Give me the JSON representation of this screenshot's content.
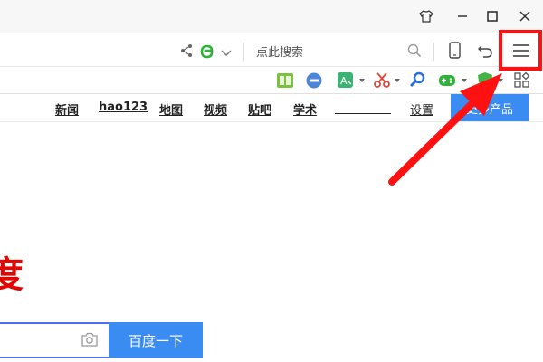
{
  "window": {
    "controls": [
      "tshirt-icon",
      "minimize-icon",
      "maximize-icon",
      "close-icon"
    ]
  },
  "addressbar": {
    "search_placeholder": "点此搜索"
  },
  "nav": {
    "links": [
      "新闻",
      "hao123",
      "地图",
      "视频",
      "贴吧",
      "学术",
      "设置"
    ],
    "more_label": "更多产品"
  },
  "logo": {
    "fragment": "度"
  },
  "search": {
    "button_label": "百度一下"
  },
  "colors": {
    "accent": "#3b8cf2",
    "annotation": "#ff1111",
    "logo": "#e10602"
  }
}
